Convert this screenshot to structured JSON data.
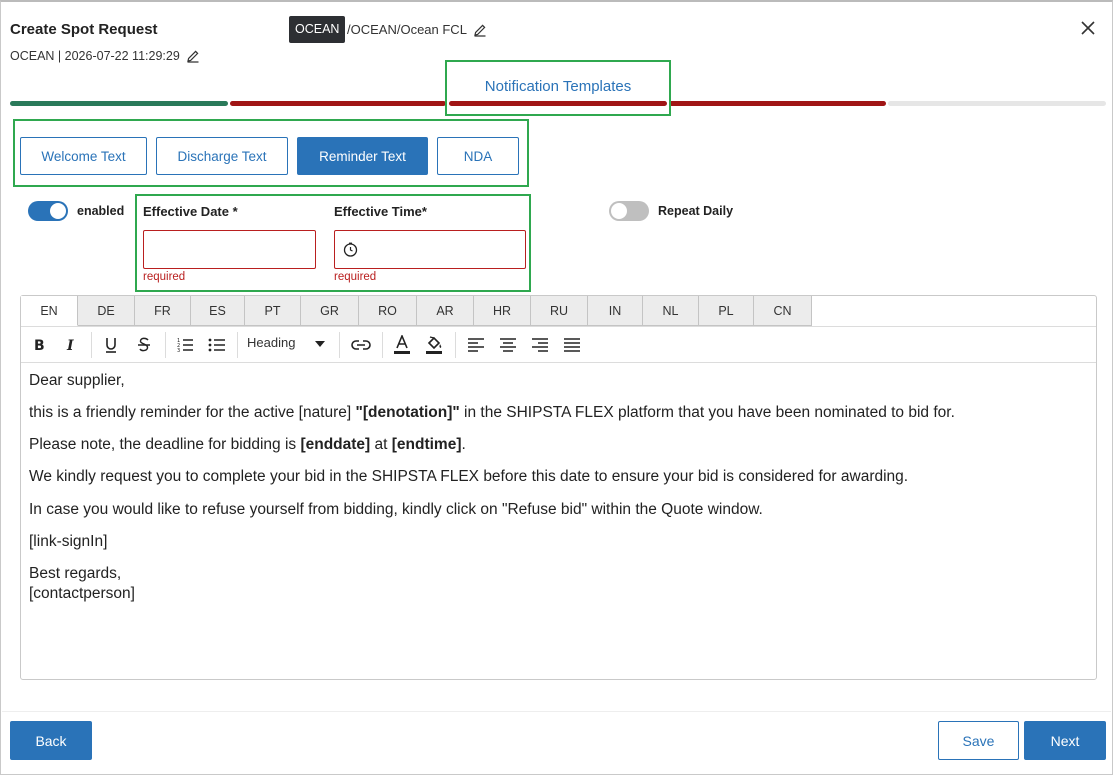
{
  "header": {
    "title": "Create Spot Request",
    "subtitle": "OCEAN | 2026-07-22 11:29:29",
    "mode_badge": "OCEAN",
    "path": "/OCEAN/Ocean FCL"
  },
  "steps": {
    "current_label": "Notification Templates",
    "colors": [
      "#2a7a5a",
      "#a01515",
      "#a01515",
      "#a01515",
      "#e6e6e6"
    ]
  },
  "templates": {
    "buttons": [
      {
        "label": "Welcome Text",
        "active": false
      },
      {
        "label": "Discharge Text",
        "active": false
      },
      {
        "label": "Reminder Text",
        "active": true
      },
      {
        "label": "NDA",
        "active": false
      }
    ]
  },
  "settings": {
    "enabled_label": "enabled",
    "enabled": true,
    "repeat_label": "Repeat Daily",
    "repeat": false,
    "effective_date_label": "Effective Date *",
    "effective_time_label": "Effective Time*",
    "effective_date_value": "",
    "effective_time_value": "",
    "required_text": "required"
  },
  "editor": {
    "languages": [
      "EN",
      "DE",
      "FR",
      "ES",
      "PT",
      "GR",
      "RO",
      "AR",
      "HR",
      "RU",
      "IN",
      "NL",
      "PL",
      "CN"
    ],
    "active_language": "EN",
    "heading_select": "Heading",
    "body": {
      "greeting": "Dear supplier,",
      "line1_a": "this is a friendly reminder for the active [nature] ",
      "line1_b": "\"[denotation]\"",
      "line1_c": " in the SHIPSTA FLEX platform that you have been nominated to bid for.",
      "line2_a": "Please note, the deadline for bidding is ",
      "line2_b": "[enddate]",
      "line2_c": " at ",
      "line2_d": "[endtime]",
      "line2_e": ".",
      "line3": "We kindly request you to complete your bid in the SHIPSTA FLEX before this date to ensure your bid is considered for awarding.",
      "line4": "In case you would like to refuse yourself from bidding, kindly click on \"Refuse bid\" within the Quote window.",
      "line5": "[link-signIn]",
      "closing": "Best regards,",
      "signature": "[contactperson]"
    }
  },
  "footer": {
    "back_label": "Back",
    "save_label": "Save",
    "next_label": "Next"
  },
  "colors": {
    "primary": "#2a73b8",
    "highlight": "#2fa84f",
    "error": "#b91f1f"
  }
}
